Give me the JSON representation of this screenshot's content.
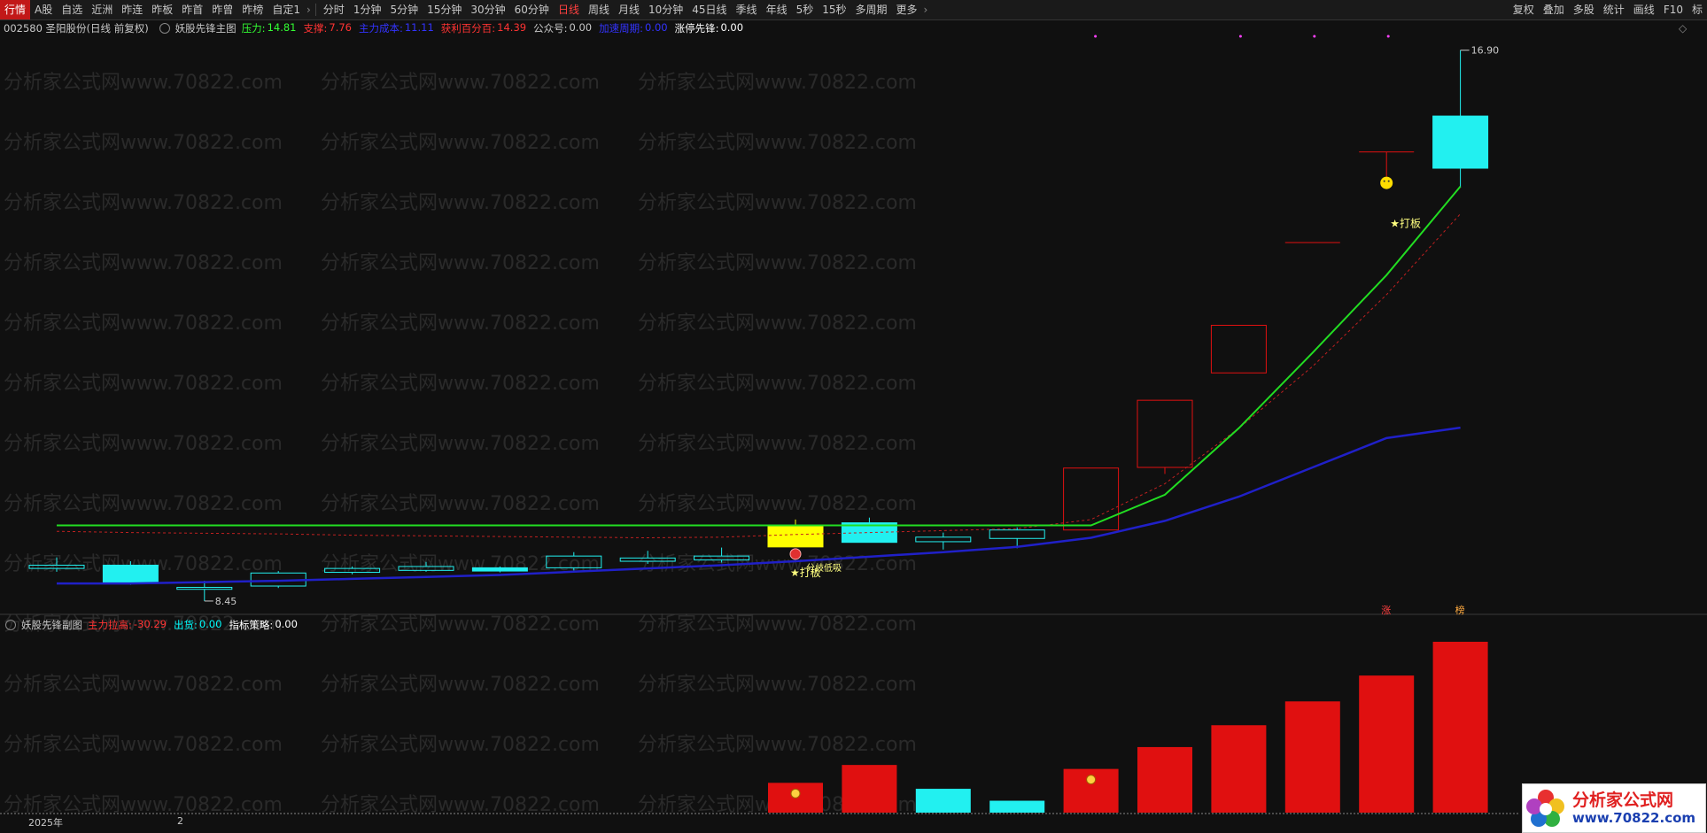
{
  "toolbar": {
    "left_tabs": [
      "行情",
      "A股",
      "自选",
      "近洲",
      "昨连",
      "昨板",
      "昨首",
      "昨曾",
      "昨榜",
      "自定1"
    ],
    "periods": [
      "分时",
      "1分钟",
      "5分钟",
      "15分钟",
      "30分钟",
      "60分钟",
      "日线",
      "周线",
      "月线",
      "10分钟",
      "45日线",
      "季线",
      "年线",
      "5秒",
      "15秒",
      "多周期",
      "更多"
    ],
    "active_period": "日线",
    "right_buttons": [
      "复权",
      "叠加",
      "多股",
      "统计",
      "画线",
      "F10",
      "标"
    ]
  },
  "main_info": {
    "stock": "002580 圣阳股份(日线 前复权)",
    "indicator": "妖股先锋主图",
    "items": [
      {
        "label": "压力:",
        "value": "14.81",
        "color": "#33ff33"
      },
      {
        "label": "支撑:",
        "value": "7.76",
        "color": "#ff3333"
      },
      {
        "label": "主力成本:",
        "value": "11.11",
        "color": "#3333ff"
      },
      {
        "label": "获利百分百:",
        "value": "14.39",
        "color": "#ff3333"
      },
      {
        "label": "公众号:",
        "value": "0.00",
        "color": "#c8c8c8"
      },
      {
        "label": "加速周期:",
        "value": "0.00",
        "color": "#3333ff"
      },
      {
        "label": "涨停先锋:",
        "value": "0.00",
        "color": "#ffffff"
      }
    ]
  },
  "sub_info": {
    "indicator": "妖股先锋副图",
    "items": [
      {
        "label": "主力拉高:",
        "value": "-30.29",
        "color": "#ff3333"
      },
      {
        "label": "出货:",
        "value": "0.00",
        "color": "#00ffff"
      },
      {
        "label": "指标策略:",
        "value": "0.00",
        "color": "#ffffff"
      }
    ]
  },
  "price_labels": {
    "high": "16.90",
    "low": "8.45"
  },
  "annotations": {
    "fen_qi_di_xi": "分歧低吸",
    "da_ban_1": "★打板",
    "da_ban_2": "★打板",
    "zhang": "涨",
    "bang": "榜"
  },
  "axis": {
    "year": "2025年",
    "month": "2"
  },
  "watermark": "分析家公式网www.70822.com",
  "logo": {
    "title": "分析家公式网",
    "url": "www.70822.com"
  },
  "chart_data": {
    "type": "candlestick",
    "candles": [
      {
        "open": 8.95,
        "close": 9.0,
        "high": 9.12,
        "low": 8.9,
        "color": "cyan",
        "filled": false
      },
      {
        "open": 9.0,
        "close": 8.72,
        "high": 9.06,
        "low": 8.7,
        "color": "cyan",
        "filled": true
      },
      {
        "open": 8.63,
        "close": 8.66,
        "high": 8.76,
        "low": 8.45,
        "color": "cyan",
        "filled": false
      },
      {
        "open": 8.68,
        "close": 8.88,
        "high": 8.91,
        "low": 8.65,
        "color": "cyan",
        "filled": false
      },
      {
        "open": 8.89,
        "close": 8.95,
        "high": 8.98,
        "low": 8.86,
        "color": "cyan",
        "filled": false
      },
      {
        "open": 8.92,
        "close": 8.98,
        "high": 9.05,
        "low": 8.9,
        "color": "cyan",
        "filled": false
      },
      {
        "open": 8.91,
        "close": 8.96,
        "high": 8.98,
        "low": 8.89,
        "color": "cyan",
        "filled": true
      },
      {
        "open": 8.96,
        "close": 9.14,
        "high": 9.2,
        "low": 8.92,
        "color": "cyan",
        "filled": false
      },
      {
        "open": 9.06,
        "close": 9.11,
        "high": 9.22,
        "low": 9.02,
        "color": "cyan",
        "filled": false
      },
      {
        "open": 9.08,
        "close": 9.14,
        "high": 9.27,
        "low": 9.04,
        "color": "cyan",
        "filled": false
      },
      {
        "open": 9.28,
        "close": 9.59,
        "high": 9.7,
        "low": 9.28,
        "color": "yellow",
        "filled": true
      },
      {
        "open": 9.35,
        "close": 9.65,
        "high": 9.73,
        "low": 9.35,
        "color": "cyan",
        "filled": true
      },
      {
        "open": 9.36,
        "close": 9.43,
        "high": 9.5,
        "low": 9.24,
        "color": "cyan",
        "filled": false
      },
      {
        "open": 9.41,
        "close": 9.54,
        "high": 9.58,
        "low": 9.26,
        "color": "cyan",
        "filled": false
      },
      {
        "open": 9.54,
        "close": 10.49,
        "high": 10.49,
        "low": 9.54,
        "color": "red",
        "filled": false
      },
      {
        "open": 10.5,
        "close": 11.53,
        "high": 11.53,
        "low": 10.4,
        "color": "red",
        "filled": false
      },
      {
        "open": 11.95,
        "close": 12.68,
        "high": 12.68,
        "low": 11.95,
        "color": "red",
        "filled": false
      },
      {
        "open": 13.95,
        "close": 13.95,
        "high": 13.95,
        "low": 13.95,
        "color": "red",
        "filled": false
      },
      {
        "open": 15.34,
        "close": 15.34,
        "high": 15.34,
        "low": 14.96,
        "color": "red",
        "filled": false
      },
      {
        "open": 15.09,
        "close": 15.89,
        "high": 16.9,
        "low": 14.79,
        "color": "cyan",
        "filled": true
      }
    ],
    "pressure_line": [
      9.61,
      9.61,
      9.61,
      9.61,
      9.61,
      9.61,
      9.61,
      9.61,
      9.61,
      9.61,
      9.61,
      9.61,
      9.61,
      9.61,
      9.61,
      10.08,
      11.1,
      12.26,
      13.45,
      14.81
    ],
    "cost_line": [
      8.72,
      8.72,
      8.74,
      8.76,
      8.79,
      8.82,
      8.85,
      8.9,
      8.95,
      9.0,
      9.06,
      9.13,
      9.2,
      9.28,
      9.42,
      9.68,
      10.05,
      10.5,
      10.95,
      11.11
    ],
    "profit_line": [
      9.52,
      9.5,
      9.49,
      9.48,
      9.46,
      9.45,
      9.44,
      9.43,
      9.42,
      9.43,
      9.47,
      9.5,
      9.53,
      9.56,
      9.7,
      10.25,
      11.1,
      12.05,
      13.15,
      14.39
    ],
    "ylim": [
      8.3,
      17.1
    ],
    "sub_bars": [
      {
        "index": 10,
        "value": 30,
        "color": "red"
      },
      {
        "index": 11,
        "value": 48,
        "color": "red"
      },
      {
        "index": 12,
        "value": 24,
        "color": "cyan"
      },
      {
        "index": 13,
        "value": 12,
        "color": "cyan"
      },
      {
        "index": 14,
        "value": 44,
        "color": "red"
      },
      {
        "index": 15,
        "value": 66,
        "color": "red"
      },
      {
        "index": 16,
        "value": 88,
        "color": "red"
      },
      {
        "index": 17,
        "value": 112,
        "color": "red"
      },
      {
        "index": 18,
        "value": 138,
        "color": "red"
      },
      {
        "index": 19,
        "value": 172,
        "color": "red"
      }
    ],
    "sub_ylim": [
      0,
      180
    ]
  }
}
